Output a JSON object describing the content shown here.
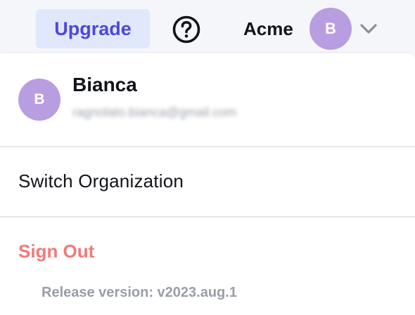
{
  "header": {
    "upgrade_label": "Upgrade",
    "help_icon": "question-circle-icon",
    "org_name": "Acme",
    "avatar_initial": "B",
    "chevron_icon": "chevron-down-icon"
  },
  "menu": {
    "avatar_initial": "B",
    "user_name": "Bianca",
    "user_email": "ragnolato.bianca@gmail.com",
    "switch_org_label": "Switch Organization",
    "sign_out_label": "Sign Out",
    "release_version": "Release version: v2023.aug.1"
  },
  "colors": {
    "accent": "#4a48dd",
    "upgrade_bg": "#e2e8fb",
    "avatar_bg": "#b89ee0",
    "danger": "#f07a78"
  }
}
